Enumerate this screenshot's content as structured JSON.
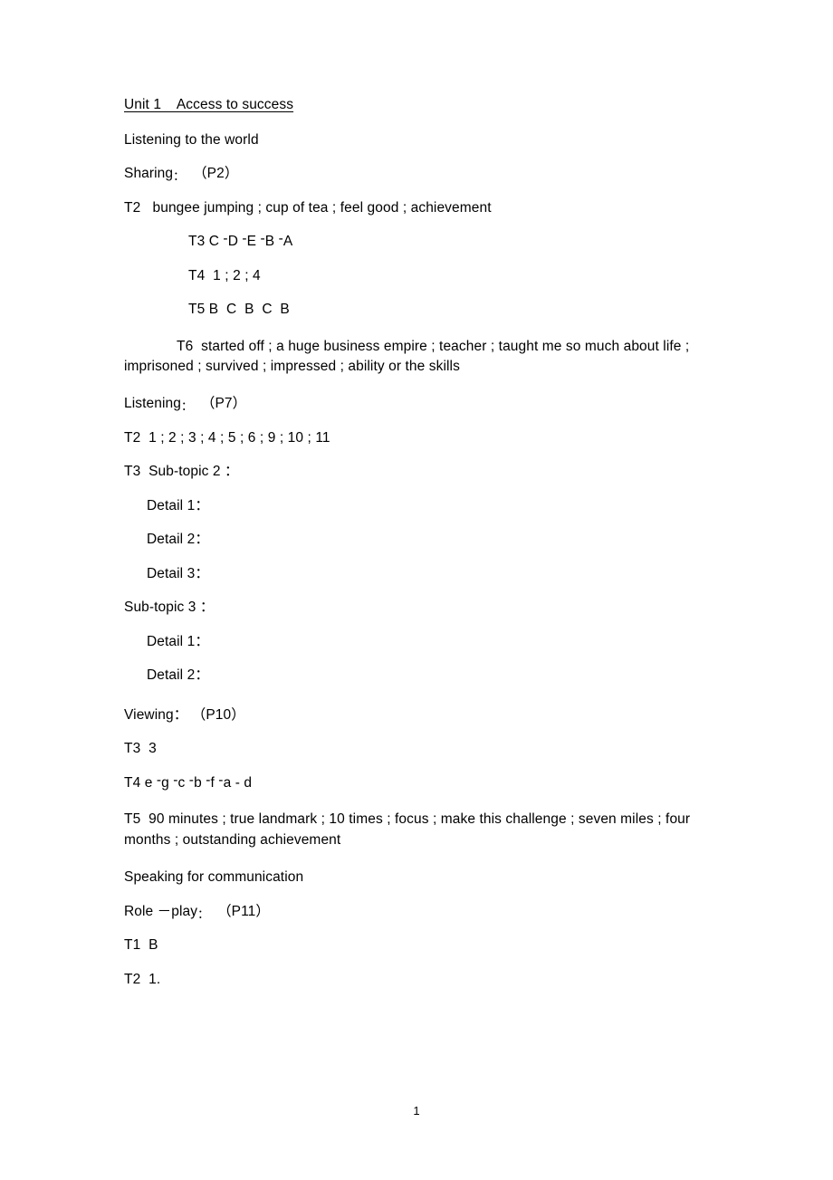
{
  "document": {
    "title": "Unit 1    Access to success",
    "page_number": "1"
  },
  "sections": {
    "listening_to_the_world": "Listening to the world",
    "speaking_for_communication": "Speaking for communication"
  },
  "sharing": {
    "heading_label": "Sharing",
    "heading_colon": "：",
    "heading_page": "（P2）",
    "t2": "T2   bungee jumping ; cup of tea ; feel good ; achievement",
    "t3_label": "T3",
    "t3_answer": "C －D －E －B －A",
    "t4_label": "T4",
    "t4_answer": "1 ; 2 ; 4",
    "t5_label": "T5",
    "t5_answer": "B  C  B  C  B",
    "t6": "T6  started off ; a huge business empire ; teacher ; taught me so much about life ; imprisoned ; survived ; impressed ; ability or the skills"
  },
  "listening": {
    "heading_label": "Listening",
    "heading_colon": "：",
    "heading_page": "（P7）",
    "t2": "T2  1 ; 2 ; 3 ; 4 ; 5 ; 6 ; 9 ; 10 ; 11",
    "t3_subtopic2": "T3  Sub-topic 2 ：",
    "details_2": [
      "Detail 1：",
      "Detail 2：",
      "Detail 3："
    ],
    "subtopic3": "Sub-topic 3 ：",
    "details_3": [
      "Detail 1：",
      "Detail 2："
    ]
  },
  "viewing": {
    "heading_label": "Viewing",
    "heading_colon": "：",
    "heading_page": "（P10）",
    "t3": "T3  3",
    "t4_label": "T4",
    "t4_answer": "e －g －c －b －f －a - d",
    "t5": "T5  90 minutes ; true landmark ; 10 times ; focus ; make this challenge ; seven miles ; four months ; outstanding achievement"
  },
  "role_play": {
    "heading_label": "Role －play",
    "heading_colon": "：",
    "heading_page": "（P11）",
    "t1": "T1  B",
    "t2": "T2  1."
  }
}
